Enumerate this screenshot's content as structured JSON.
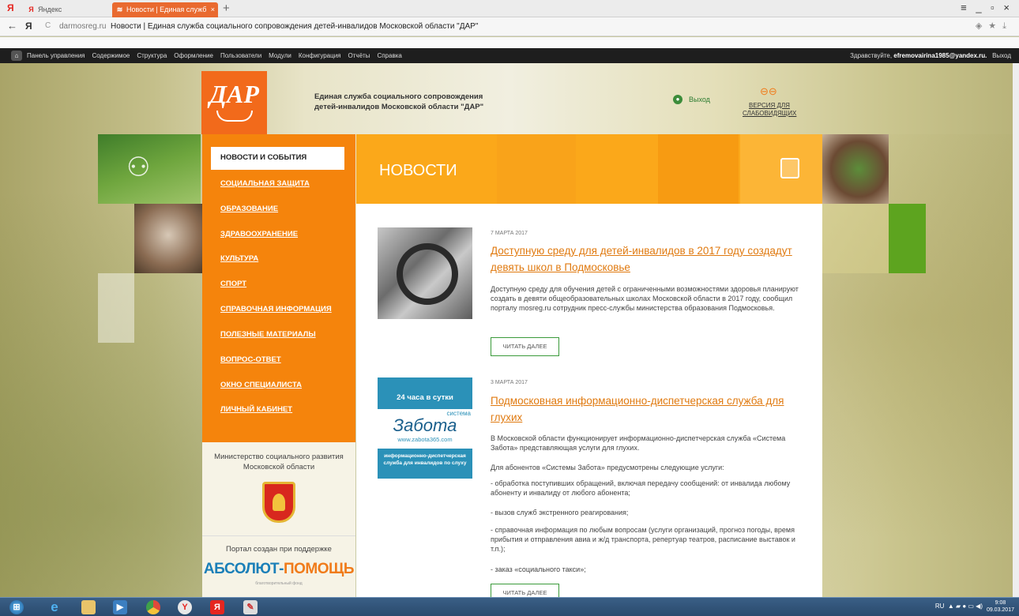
{
  "browser": {
    "tabs": [
      {
        "label": "Яндекс"
      },
      {
        "label": "Новости | Единая служб"
      }
    ],
    "yandex_logo": "Я",
    "new_tab": "+",
    "window_controls": "≡ _ ▫ ×",
    "url_domain": "darmosreg.ru",
    "url_title": "Новости | Единая служба социального сопровождения детей-инвалидов Московской области \"ДАР\"",
    "back": "←",
    "reload": "C"
  },
  "admin": {
    "menu": [
      "Панель управления",
      "Содержимое",
      "Структура",
      "Оформление",
      "Пользователи",
      "Модули",
      "Конфигурация",
      "Отчёты",
      "Справка"
    ],
    "greeting": "Здравствуйте, ",
    "user_email": "efremovairina1985@yandex.ru.",
    "logout": "Выход"
  },
  "header": {
    "logo_text": "ДАР",
    "site_title_line1": "Единая служба социального сопровождения",
    "site_title_line2": "детей-инвалидов Московской области \"ДАР\"",
    "exit": "Выход",
    "low_vision_line1": "ВЕРСИЯ ДЛЯ",
    "low_vision_line2": "СЛАБОВИДЯЩИХ"
  },
  "menu": {
    "active": "НОВОСТИ И СОБЫТИЯ",
    "items": [
      "СОЦИАЛЬНАЯ ЗАЩИТА",
      "ОБРАЗОВАНИЕ",
      "ЗДРАВООХРАНЕНИЕ",
      "КУЛЬТУРА",
      "СПОРТ",
      "СПРАВОЧНАЯ ИНФОРМАЦИЯ",
      "ПОЛЕЗНЫЕ МАТЕРИАЛЫ",
      "ВОПРОС-ОТВЕТ",
      "ОКНО СПЕЦИАЛИСТА",
      "ЛИЧНЫЙ КАБИНЕТ"
    ]
  },
  "sidebox": {
    "ministry_line1": "Министерство социального развития",
    "ministry_line2": "Московской области",
    "supported": "Портал создан при поддержке",
    "absolut_a": "АБСОЛЮТ-",
    "absolut_b": "ПОМОЩЬ",
    "absolut_sub": "благотворительный фонд"
  },
  "page": {
    "title": "НОВОСТИ"
  },
  "news": [
    {
      "date": "7 МАРТА 2017",
      "title": "Доступную среду для детей-инвалидов в 2017 году создадут девять школ в Подмосковье",
      "text": "Доступную среду для обучения детей с ограниченными возможностями здоровья планируют создать в девяти общеобразовательных школах Московской области в 2017 году, сообщил порталу mosreg.ru сотрудник пресс-службы министерства образования Подмосковья.",
      "button": "ЧИТАТЬ ДАЛЕЕ"
    },
    {
      "date": "3 МАРТА 2017",
      "title": "Подмосковная информационно-диспетчерская служба для глухих",
      "p1": "В Московской области функционирует информационно-диспетчерская служба «Система Забота» представляющая услуги для глухих.",
      "p2": "Для абонентов «Системы Забота» предусмотрены следующие услуги:",
      "p3": "- обработка поступивших обращений, включая передачу сообщений: от инвалида любому абоненту и инвалиду от любого абонента;",
      "p4": "- вызов служб экстренного реагирования;",
      "p5": "- справочная информация по любым вопросам (услуги организаций, прогноз погоды, время прибытия и отправления авиа и ж/д транспорта, репертуар театров, расписание выставок и т.п.);",
      "p6": "- заказ «социального такси»;",
      "button": "ЧИТАТЬ ДАЛЕЕ",
      "thumb_top": "24 часа в сутки",
      "thumb_sys": "система",
      "thumb_brand": "Забота",
      "thumb_url": "www.zabota365.com",
      "thumb_bottom": "информационно-диспетчерская служба для инвалидов по слуху"
    }
  ],
  "taskbar": {
    "lang": "RU",
    "time": "9:08",
    "date": "09.03.2017"
  },
  "colors": {
    "accent": "#f5840c",
    "header_orange": "#fba81a",
    "link": "#e07a10",
    "green": "#3a9a3a"
  }
}
